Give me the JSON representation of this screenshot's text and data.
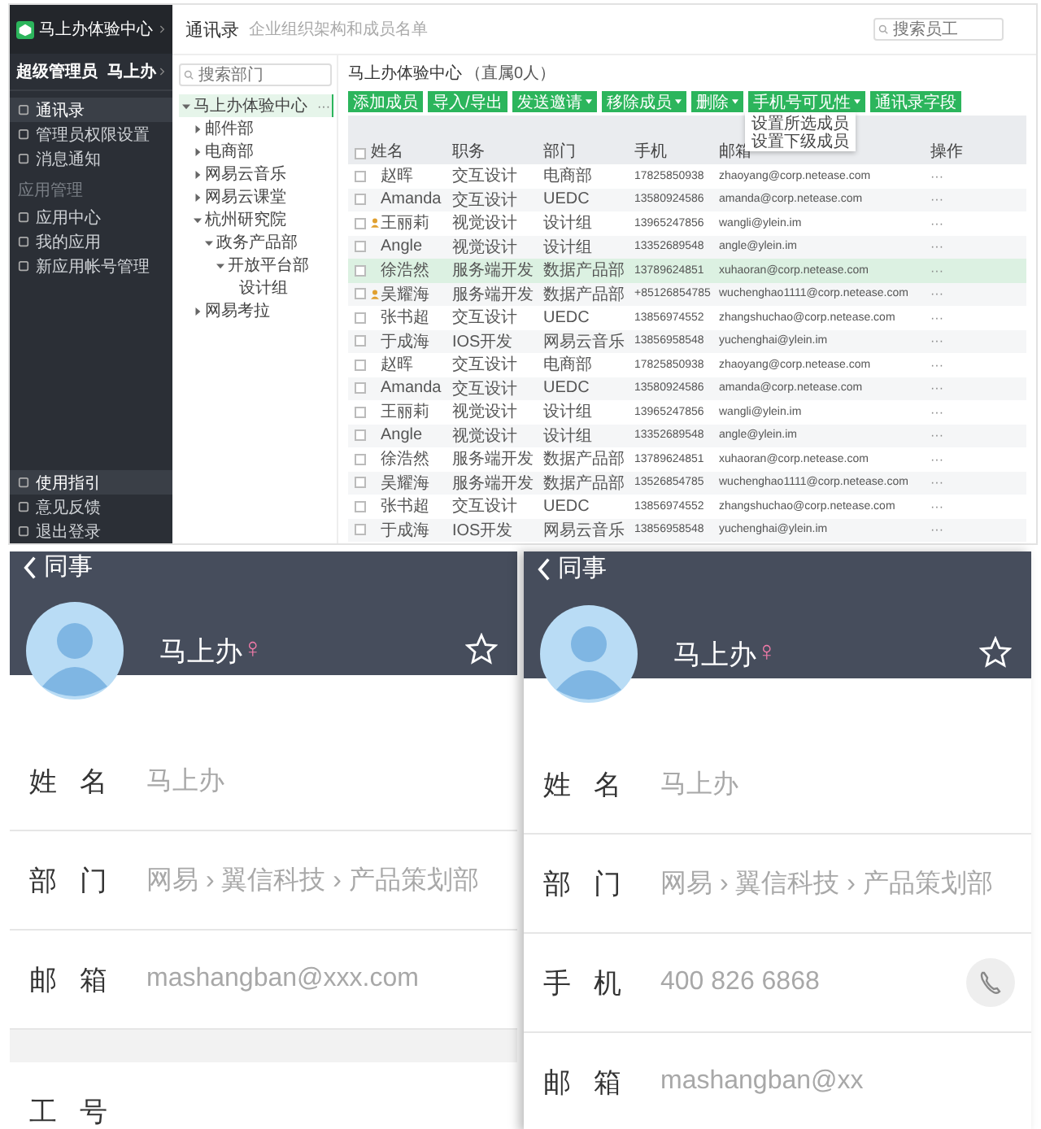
{
  "admin_console": {
    "sidebar": {
      "brand": "马上办体验中心",
      "admin": "超级管理员 马上办",
      "menu": [
        {
          "label": "通讯录",
          "selected": true
        },
        {
          "label": "管理员权限设置",
          "selected": false
        },
        {
          "label": "消息通知",
          "selected": false
        }
      ],
      "section": "应用管理",
      "apps": [
        {
          "label": "应用中心",
          "selected": false
        },
        {
          "label": "我的应用",
          "selected": false
        },
        {
          "label": "新应用帐号管理",
          "selected": false
        }
      ],
      "footer": [
        {
          "label": "使用指引",
          "selected": true
        },
        {
          "label": "意见反馈",
          "selected": false
        },
        {
          "label": "退出登录",
          "selected": false
        }
      ]
    },
    "header": {
      "title": "通讯录",
      "subtitle": "企业组织架构和成员名单",
      "search": {
        "placeholder": "搜索员工"
      }
    },
    "tree": {
      "search": {
        "placeholder": "搜索部门"
      },
      "nodes": [
        {
          "label": "马上办体验中心",
          "selected": true,
          "expanded": true,
          "more": "···",
          "children": [
            {
              "label": "邮件部",
              "selected": false,
              "expanded": false
            },
            {
              "label": "电商部",
              "selected": false,
              "expanded": false
            },
            {
              "label": "网易云音乐",
              "selected": false,
              "expanded": false
            },
            {
              "label": "网易云课堂",
              "selected": false,
              "expanded": false
            },
            {
              "label": "杭州研究院",
              "selected": false,
              "expanded": true,
              "children": [
                {
                  "label": "政务产品部",
                  "selected": false,
                  "expanded": true,
                  "children": [
                    {
                      "label": "开放平台部",
                      "selected": false,
                      "expanded": true,
                      "children": [
                        {
                          "label": "设计组",
                          "selected": false
                        }
                      ]
                    }
                  ]
                }
              ]
            },
            {
              "label": "网易考拉",
              "selected": false,
              "expanded": false
            }
          ]
        }
      ]
    },
    "department": {
      "title": "马上办体验中心",
      "count": "（直属0人）"
    },
    "toolbar": [
      {
        "label": "添加成员",
        "caret": false
      },
      {
        "label": "导入/导出",
        "caret": false
      },
      {
        "label": "发送邀请",
        "caret": true
      },
      {
        "label": "移除成员",
        "caret": true
      },
      {
        "label": "删除",
        "caret": true
      },
      {
        "label": "手机号可见性",
        "caret": true
      },
      {
        "label": "通讯录字段",
        "caret": false
      }
    ],
    "dropdown": {
      "items": [
        "设置所选成员",
        "设置下级成员"
      ]
    },
    "table": {
      "all_checked": false,
      "columns": [
        "姓名",
        "职务",
        "部门",
        "手机",
        "邮箱",
        "操作"
      ],
      "rows": [
        {
          "avatar": false,
          "checked": false,
          "selected": false,
          "cells": [
            "赵晖",
            "交互设计",
            "电商部",
            "17825850938",
            "zhaoyang@corp.netease.com",
            "···"
          ]
        },
        {
          "avatar": false,
          "checked": false,
          "selected": false,
          "cells": [
            "Amanda",
            "交互设计",
            "UEDC",
            "13580924586",
            "amanda@corp.netease.com",
            "···"
          ]
        },
        {
          "avatar": true,
          "checked": false,
          "selected": false,
          "cells": [
            "王丽莉",
            "视觉设计",
            "设计组",
            "13965247856",
            "wangli@ylein.im",
            "···"
          ]
        },
        {
          "avatar": false,
          "checked": false,
          "selected": false,
          "cells": [
            "Angle",
            "视觉设计",
            "设计组",
            "13352689548",
            "angle@ylein.im",
            "···"
          ]
        },
        {
          "avatar": false,
          "checked": false,
          "selected": true,
          "cells": [
            "徐浩然",
            "服务端开发",
            "数据产品部",
            "13789624851",
            "xuhaoran@corp.netease.com",
            "···"
          ]
        },
        {
          "avatar": true,
          "checked": false,
          "selected": false,
          "cells": [
            "吴耀海",
            "服务端开发",
            "数据产品部",
            "+85126854785",
            "wuchenghao1111@corp.netease.com",
            "···"
          ]
        },
        {
          "avatar": false,
          "checked": false,
          "selected": false,
          "cells": [
            "张书超",
            "交互设计",
            "UEDC",
            "13856974552",
            "zhangshuchao@corp.netease.com",
            "···"
          ]
        },
        {
          "avatar": false,
          "checked": false,
          "selected": false,
          "cells": [
            "于成海",
            "IOS开发",
            "网易云音乐",
            "13856958548",
            "yuchenghai@ylein.im",
            "···"
          ]
        },
        {
          "avatar": false,
          "checked": false,
          "selected": false,
          "cells": [
            "赵晖",
            "交互设计",
            "电商部",
            "17825850938",
            "zhaoyang@corp.netease.com",
            "···"
          ]
        },
        {
          "avatar": false,
          "checked": false,
          "selected": false,
          "cells": [
            "Amanda",
            "交互设计",
            "UEDC",
            "13580924586",
            "amanda@corp.netease.com",
            "···"
          ]
        },
        {
          "avatar": false,
          "checked": false,
          "selected": false,
          "cells": [
            "王丽莉",
            "视觉设计",
            "设计组",
            "13965247856",
            "wangli@ylein.im",
            "···"
          ]
        },
        {
          "avatar": false,
          "checked": false,
          "selected": false,
          "cells": [
            "Angle",
            "视觉设计",
            "设计组",
            "13352689548",
            "angle@ylein.im",
            "···"
          ]
        },
        {
          "avatar": false,
          "checked": false,
          "selected": false,
          "cells": [
            "徐浩然",
            "服务端开发",
            "数据产品部",
            "13789624851",
            "xuhaoran@corp.netease.com",
            "···"
          ]
        },
        {
          "avatar": false,
          "checked": false,
          "selected": false,
          "cells": [
            "吴耀海",
            "服务端开发",
            "数据产品部",
            "13526854785",
            "wuchenghao1111@corp.netease.com",
            "···"
          ]
        },
        {
          "avatar": false,
          "checked": false,
          "selected": false,
          "cells": [
            "张书超",
            "交互设计",
            "UEDC",
            "13856974552",
            "zhangshuchao@corp.netease.com",
            "···"
          ]
        },
        {
          "avatar": false,
          "checked": false,
          "selected": false,
          "cells": [
            "于成海",
            "IOS开发",
            "网易云音乐",
            "13856958548",
            "yuchenghai@ylein.im",
            "···"
          ]
        }
      ]
    }
  },
  "phones": [
    {
      "nav_title": "同事",
      "name": "马上办",
      "gender": "♀",
      "rows": [
        {
          "kind": "field",
          "label": "姓名",
          "value": "马上办"
        },
        {
          "kind": "field",
          "label": "部门",
          "value": "网易 › 翼信科技 › 产品策划部"
        },
        {
          "kind": "field",
          "label": "邮箱",
          "value": "mashangban@xxx.com"
        },
        {
          "kind": "gap"
        },
        {
          "kind": "field",
          "label": "工号"
        }
      ]
    },
    {
      "nav_title": "同事",
      "name": "马上办",
      "gender": "♀",
      "rows": [
        {
          "kind": "field",
          "label": "姓名",
          "value": "马上办"
        },
        {
          "kind": "field",
          "label": "部门",
          "value": "网易 › 翼信科技 › 产品策划部"
        },
        {
          "kind": "phone",
          "label": "手机",
          "value": "400 826 6868"
        },
        {
          "kind": "field",
          "label": "邮箱",
          "value": "mashangban@xx"
        }
      ]
    }
  ]
}
